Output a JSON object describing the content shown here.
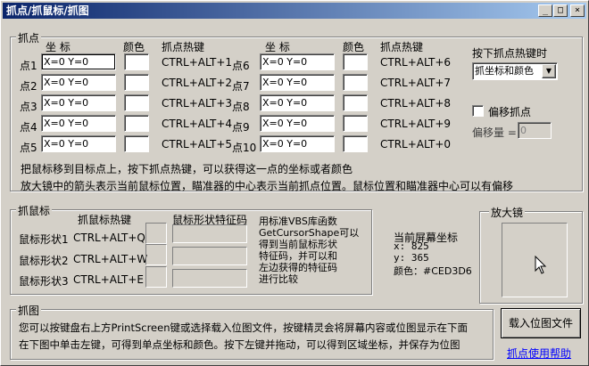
{
  "window": {
    "title": "抓点/抓鼠标/抓图",
    "minimize": "_",
    "maximize": "□",
    "close": "×"
  },
  "points_group": {
    "legend": "抓点",
    "col_coord": "坐 标",
    "col_color": "颜色",
    "col_hotkey": "抓点热键",
    "left": [
      {
        "label": "点1",
        "value": "X=0 Y=0",
        "hotkey": "CTRL+ALT+1"
      },
      {
        "label": "点2",
        "value": "X=0 Y=0",
        "hotkey": "CTRL+ALT+2"
      },
      {
        "label": "点3",
        "value": "X=0 Y=0",
        "hotkey": "CTRL+ALT+3"
      },
      {
        "label": "点4",
        "value": "X=0 Y=0",
        "hotkey": "CTRL+ALT+4"
      },
      {
        "label": "点5",
        "value": "X=0 Y=0",
        "hotkey": "CTRL+ALT+5"
      }
    ],
    "right": [
      {
        "label": "点6",
        "value": "X=0 Y=0",
        "hotkey": "CTRL+ALT+6"
      },
      {
        "label": "点7",
        "value": "X=0 Y=0",
        "hotkey": "CTRL+ALT+7"
      },
      {
        "label": "点8",
        "value": "X=0 Y=0",
        "hotkey": "CTRL+ALT+8"
      },
      {
        "label": "点9",
        "value": "X=0 Y=0",
        "hotkey": "CTRL+ALT+9"
      },
      {
        "label": "点10",
        "value": "X=0 Y=0",
        "hotkey": "CTRL+ALT+0"
      }
    ],
    "on_hotkey_label": "按下抓点热键时",
    "on_hotkey_select": "抓坐标和颜色",
    "offset_checkbox": "偏移抓点",
    "offset_label": "偏移量 =",
    "offset_value": "0",
    "hint1": "把鼠标移到目标点上，按下抓点热键，可以获得这一点的坐标或者颜色",
    "hint2": "放大镜中的箭头表示当前鼠标位置，瞄准器的中心表示当前抓点位置。鼠标位置和瞄准器中心可以有偏移"
  },
  "mouse_group": {
    "legend": "抓鼠标",
    "col_hotkey": "抓鼠标热键",
    "col_code": "鼠标形状特征码",
    "rows": [
      {
        "label": "鼠标形状1",
        "hotkey": "CTRL+ALT+Q"
      },
      {
        "label": "鼠标形状2",
        "hotkey": "CTRL+ALT+W"
      },
      {
        "label": "鼠标形状3",
        "hotkey": "CTRL+ALT+E"
      }
    ],
    "description": [
      "用标准VBS库函数",
      "GetCursorShape可以",
      "得到当前鼠标形状",
      "特征码，并可以和",
      "左边获得的特征码",
      "进行比较"
    ]
  },
  "screen_info": {
    "title": "当前屏幕坐标",
    "x": "x: 825",
    "y": "y: 365",
    "color": "颜色：#CED3D6"
  },
  "magnifier": {
    "legend": "放大镜"
  },
  "capture_group": {
    "legend": "抓图",
    "line1": "您可以按键盘右上方PrintScreen键或选择载入位图文件，按键精灵会将屏幕内容或位图显示在下面",
    "line2": "在下图中单击左键，可得到单点坐标和颜色。按下左键并拖动，可以得到区域坐标，并保存为位图"
  },
  "load_bitmap_button": "载入位图文件",
  "help_link": "抓点使用帮助",
  "colors": {
    "titlebar_start": "#0a246a",
    "titlebar_end": "#a6caf0",
    "face": "#d4d0c8",
    "link": "#0000ff"
  }
}
